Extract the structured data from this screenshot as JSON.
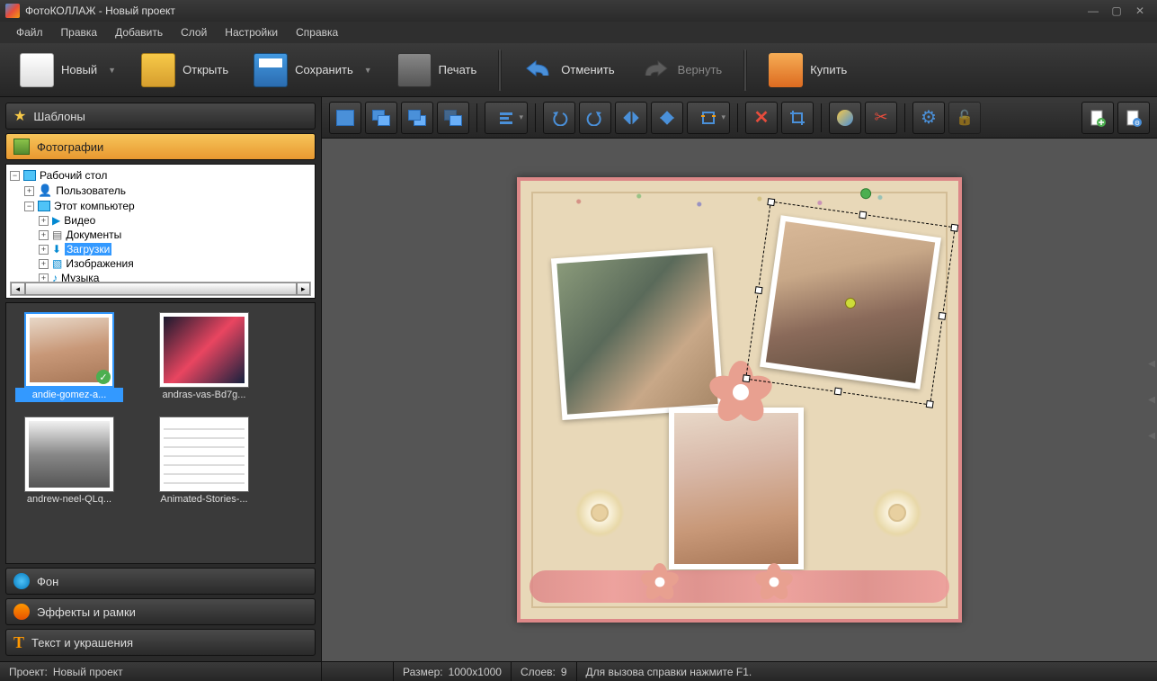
{
  "title": "ФотоКОЛЛАЖ - Новый проект",
  "menu": [
    "Файл",
    "Правка",
    "Добавить",
    "Слой",
    "Настройки",
    "Справка"
  ],
  "toolbar": {
    "new": "Новый",
    "open": "Открыть",
    "save": "Сохранить",
    "print": "Печать",
    "undo": "Отменить",
    "redo": "Вернуть",
    "buy": "Купить"
  },
  "sidebar": {
    "templates": "Шаблоны",
    "photos": "Фотографии",
    "background": "Фон",
    "effects": "Эффекты и рамки",
    "text": "Текст и украшения"
  },
  "tree": {
    "desktop": "Рабочий стол",
    "user": "Пользователь",
    "thispc": "Этот компьютер",
    "video": "Видео",
    "documents": "Документы",
    "downloads": "Загрузки",
    "images": "Изображения",
    "music": "Музыка"
  },
  "thumbs": [
    {
      "label": "andie-gomez-a...",
      "selected": true,
      "checked": true
    },
    {
      "label": "andras-vas-Bd7g...",
      "selected": false,
      "checked": false
    },
    {
      "label": "andrew-neel-QLq...",
      "selected": false,
      "checked": false
    },
    {
      "label": "Animated-Stories-...",
      "selected": false,
      "checked": false
    }
  ],
  "status": {
    "project_label": "Проект:",
    "project_value": "Новый проект",
    "size_label": "Размер:",
    "size_value": "1000x1000",
    "layers_label": "Слоев:",
    "layers_value": "9",
    "help": "Для вызова справки нажмите F1."
  }
}
